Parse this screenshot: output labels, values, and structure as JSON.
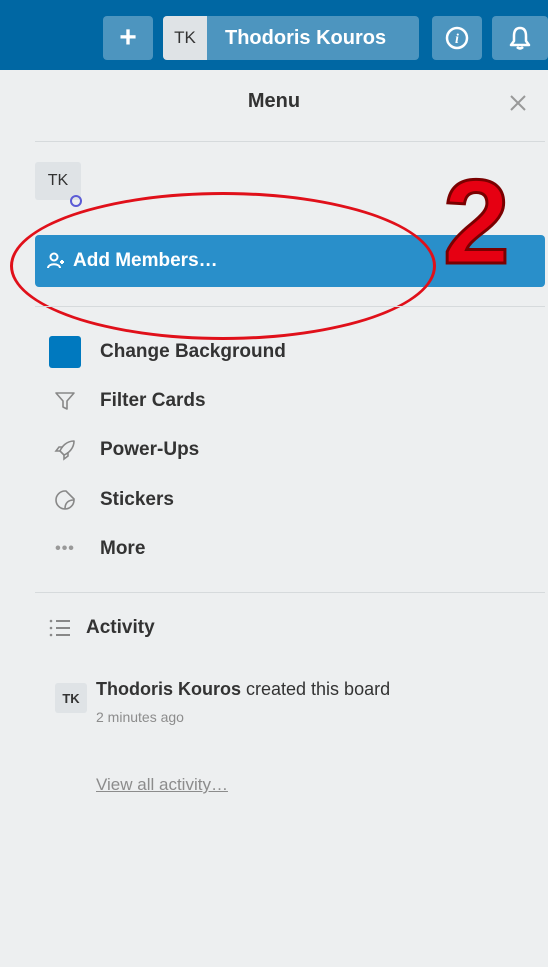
{
  "topbar": {
    "add_label": "+",
    "user_initials": "TK",
    "user_name": "Thodoris Kouros",
    "info_icon": "info-icon",
    "bell_icon": "bell-icon",
    "bg_color": "#0067a3"
  },
  "menu": {
    "title": "Menu",
    "close_label": "✕",
    "member_initials": "TK",
    "add_members_label": "Add Members…",
    "items": [
      {
        "label": "Change Background",
        "icon": "background-swatch"
      },
      {
        "label": "Filter Cards",
        "icon": "filter-icon"
      },
      {
        "label": "Power-Ups",
        "icon": "rocket-icon"
      },
      {
        "label": "Stickers",
        "icon": "sticker-icon"
      },
      {
        "label": "More",
        "icon": "more-icon"
      }
    ]
  },
  "activity": {
    "title": "Activity",
    "entry": {
      "initials": "TK",
      "user": "Thodoris Kouros",
      "action": " created this board",
      "time": "2 minutes ago"
    },
    "view_all": "View all activity…"
  },
  "annotation": {
    "number": "2",
    "color": "#e60012"
  }
}
